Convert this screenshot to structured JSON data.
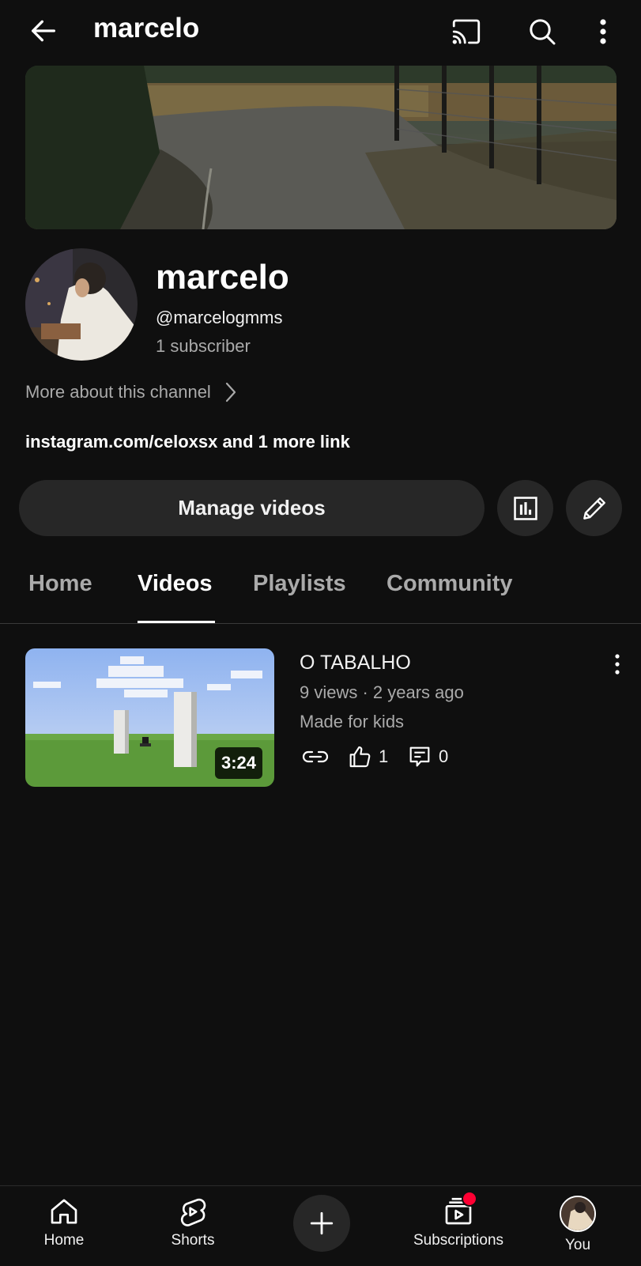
{
  "header": {
    "title": "marcelo",
    "icons": [
      "back-arrow-icon",
      "cast-icon",
      "search-icon",
      "more-vert-icon"
    ]
  },
  "channel": {
    "name": "marcelo",
    "handle": "@marcelogmms",
    "subscribers": "1 subscriber",
    "more_about": "More about this channel",
    "links": "instagram.com/celoxsx and 1 more link"
  },
  "actions": {
    "manage_videos": "Manage videos",
    "icons": [
      "analytics-icon",
      "edit-pencil-icon"
    ]
  },
  "tabs": [
    {
      "label": "Home",
      "active": false
    },
    {
      "label": "Videos",
      "active": true
    },
    {
      "label": "Playlists",
      "active": false
    },
    {
      "label": "Community",
      "active": false
    }
  ],
  "videos": [
    {
      "title": "O TABALHO",
      "meta": "9 views · 2 years ago",
      "audience": "Made for kids",
      "duration": "3:24",
      "likes": "1",
      "comments": "0"
    }
  ],
  "bottom_nav": [
    {
      "label": "Home",
      "icon": "home-icon"
    },
    {
      "label": "Shorts",
      "icon": "shorts-icon"
    },
    {
      "label": "",
      "icon": "plus-icon"
    },
    {
      "label": "Subscriptions",
      "icon": "subscriptions-icon"
    },
    {
      "label": "You",
      "icon": "avatar"
    }
  ],
  "colors": {
    "background": "#0f0f0f",
    "surface": "#272727",
    "text_secondary": "#aaaaaa",
    "notification": "#ff0033"
  }
}
